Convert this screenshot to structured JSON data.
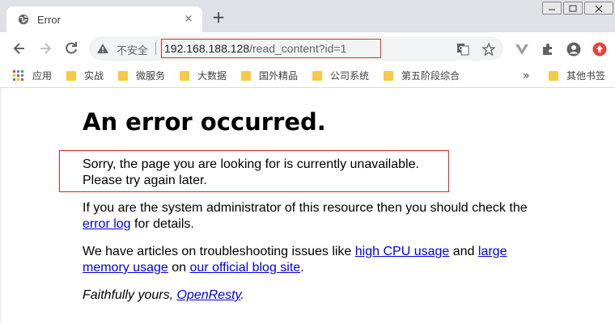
{
  "window": {
    "tab_title": "Error",
    "new_tab_symbol": "+",
    "close_tab_symbol": "×"
  },
  "toolbar": {
    "security_label": "不安全",
    "url_host": "192.168.188.128",
    "url_path": "/read_content?id=1"
  },
  "bookmarks": {
    "apps_label": "应用",
    "items": [
      "实战",
      "微服务",
      "大数据",
      "国外精品",
      "公司系统",
      "第五阶段综合"
    ],
    "overflow_symbol": "»",
    "other_label": "其他书签"
  },
  "page": {
    "heading": "An error occurred.",
    "sorry_line1": "Sorry, the page you are looking for is currently unavailable.",
    "sorry_line2": "Please try again later.",
    "admin_line1": "If you are the system administrator of this resource then you should check the",
    "admin_link": "error log",
    "admin_suffix": " for details.",
    "articles_prefix": "We have articles on troubleshooting issues like ",
    "cpu_link": "high CPU usage",
    "and_text": " and ",
    "large_link": "large",
    "memory_link": "memory usage",
    "on_text": " on ",
    "blog_link": "our official blog site",
    "period": ".",
    "faithfully": "Faithfully yours, ",
    "openresty_link": "OpenResty",
    "end_period": "."
  },
  "colors": {
    "accent_red": "#d93025",
    "link_blue": "#0000ee"
  },
  "icons": [
    "globe-icon",
    "back-arrow-icon",
    "forward-arrow-icon",
    "reload-icon",
    "warning-icon",
    "translate-icon",
    "star-icon",
    "vue-devtools-icon",
    "extensions-icon",
    "profile-icon",
    "update-icon",
    "apps-grid-icon",
    "folder-icon"
  ]
}
